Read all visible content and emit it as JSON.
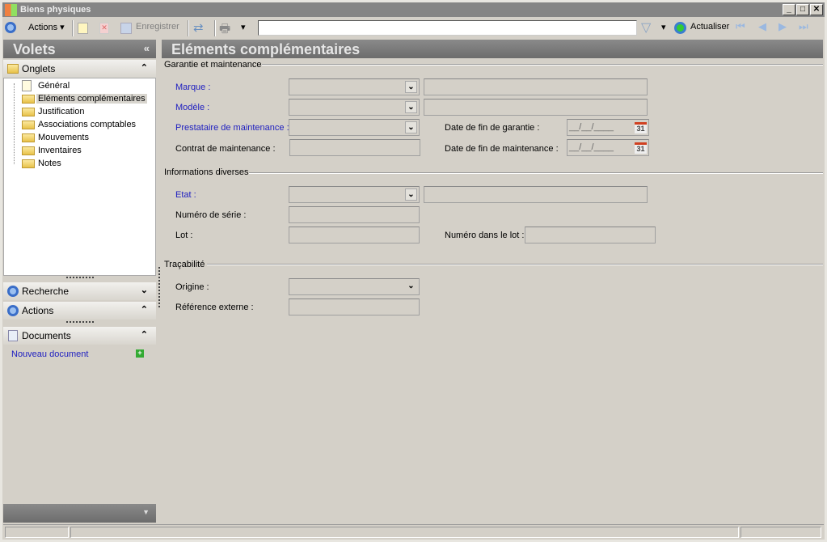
{
  "window": {
    "title": "Biens physiques",
    "minimize": "_",
    "maximize": "□",
    "close": "✕"
  },
  "toolbar": {
    "actions": "Actions",
    "save": "Enregistrer",
    "search_value": "",
    "refresh": "Actualiser"
  },
  "left": {
    "title": "Volets",
    "collapse": "«",
    "onglets": {
      "title": "Onglets",
      "items": [
        "Général",
        "Eléments complémentaires",
        "Justification",
        "Associations comptables",
        "Mouvements",
        "Inventaires",
        "Notes"
      ],
      "selected": 1
    },
    "recherche": "Recherche",
    "actions": "Actions",
    "documents": "Documents",
    "new_document": "Nouveau document"
  },
  "main": {
    "title": "Eléments complémentaires",
    "sections": {
      "garantie": "Garantie et maintenance",
      "infos": "Informations diverses",
      "trace": "Traçabilité"
    },
    "labels": {
      "marque": "Marque :",
      "modele": "Modèle :",
      "prestataire": "Prestataire de maintenance :",
      "contrat": "Contrat de maintenance :",
      "fin_garantie": "Date de fin de garantie :",
      "fin_maintenance": "Date de fin de maintenance :",
      "etat": "Etat :",
      "serie": "Numéro de série :",
      "lot": "Lot :",
      "num_lot": "Numéro dans le lot :",
      "origine": "Origine :",
      "ref_ext": "Référence externe :"
    },
    "date_mask": "__/__/____",
    "calendar_day": "31"
  }
}
